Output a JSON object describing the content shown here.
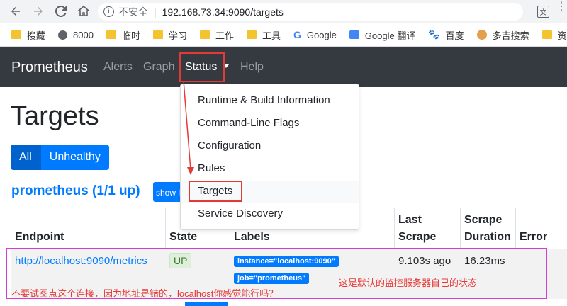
{
  "browser": {
    "insecure_label": "不安全",
    "url": "192.168.73.34:9090/targets",
    "bookmarks": [
      {
        "label": "搜藏",
        "icon": "folder-icon"
      },
      {
        "label": "8000",
        "icon": "globe-icon"
      },
      {
        "label": "临时",
        "icon": "folder-icon"
      },
      {
        "label": "学习",
        "icon": "folder-icon"
      },
      {
        "label": "工作",
        "icon": "folder-icon"
      },
      {
        "label": "工具",
        "icon": "folder-icon"
      },
      {
        "label": "Google",
        "icon": "google-icon"
      },
      {
        "label": "Google 翻译",
        "icon": "google-translate-icon"
      },
      {
        "label": "百度",
        "icon": "baidu-paw-icon"
      },
      {
        "label": "多吉搜索",
        "icon": "dogedoge-icon"
      },
      {
        "label": "资源S",
        "icon": "folder-icon"
      }
    ]
  },
  "navbar": {
    "brand": "Prometheus",
    "alerts": "Alerts",
    "graph": "Graph",
    "status": "Status",
    "help": "Help"
  },
  "dropdown": {
    "items": [
      "Runtime & Build Information",
      "Command-Line Flags",
      "Configuration",
      "Rules",
      "Targets",
      "Service Discovery"
    ]
  },
  "page": {
    "title": "Targets",
    "filter_all": "All",
    "filter_unhealthy": "Unhealthy",
    "pool_heading": "prometheus (1/1 up)",
    "show_less": "show l"
  },
  "table": {
    "headers": {
      "endpoint": "Endpoint",
      "state": "State",
      "labels": "Labels",
      "last_scrape_1": "Last",
      "last_scrape_2": "Scrape",
      "scrape_duration_1": "Scrape",
      "scrape_duration_2": "Duration",
      "error": "Error"
    },
    "row": {
      "endpoint": "http://localhost:9090/metrics",
      "state": "UP",
      "label_instance": "instance=\"localhost:9090\"",
      "label_job": "job=\"prometheus\"",
      "last_scrape": "9.103s ago",
      "scrape_duration": "16.23ms",
      "error": ""
    }
  },
  "annotations": {
    "note_left": "不要试图点这个连接，因为地址是错的，localhost你感觉能行吗？",
    "note_right": "这是默认的监控服务器自己的状态"
  },
  "colors": {
    "navbar_bg": "#343a40",
    "primary": "#007bff",
    "highlight_red": "#e53935",
    "annotation_magenta": "#d63dd6"
  }
}
